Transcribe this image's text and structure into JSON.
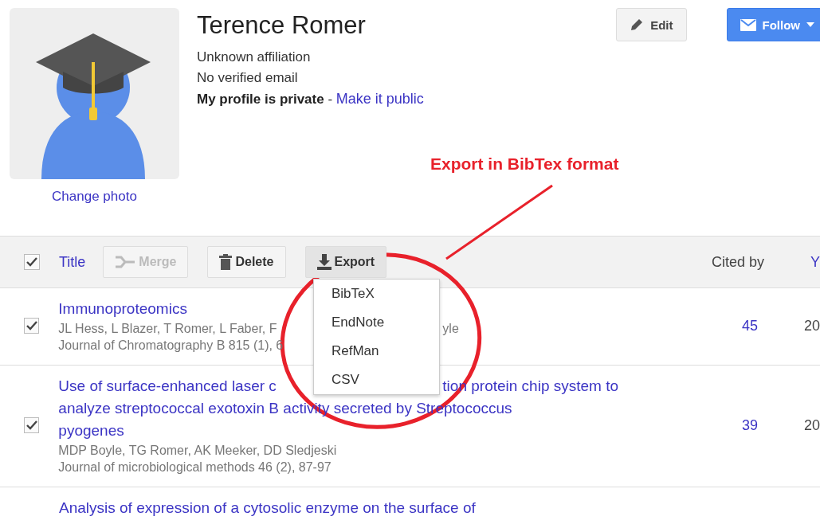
{
  "profile": {
    "name": "Terence Romer",
    "affiliation": "Unknown affiliation",
    "email": "No verified email",
    "privacy": "My profile is private",
    "privacy_separator": "-",
    "privacy_link": "Make it public",
    "change_photo": "Change photo"
  },
  "actions": [
    {
      "label": "Edit",
      "kind": "edit"
    },
    {
      "label": "Follow",
      "kind": "follow"
    }
  ],
  "annotation": {
    "text": "Export in BibTex format"
  },
  "toolbar": {
    "select_all_checked": true,
    "title_column": "Title",
    "buttons": [
      {
        "label": "Merge",
        "kind": "merge",
        "disabled": true
      },
      {
        "label": "Delete",
        "kind": "delete",
        "disabled": false
      },
      {
        "label": "Export",
        "kind": "export",
        "disabled": false
      }
    ],
    "cited_by_column": "Cited by",
    "column_4": "Y"
  },
  "export_menu": {
    "items": [
      "BibTeX",
      "EndNote",
      "RefMan",
      "CSV"
    ]
  },
  "rows": [
    {
      "checked": true,
      "title": [
        [
          "Immunoproteomics"
        ]
      ],
      "authors": [
        "JL Hess, L Blazer, T Romer, L Faber, F",
        "yle"
      ],
      "source": [
        "Journal of Chromatography B 815 (1), 6"
      ],
      "cited_by": "45",
      "column_4": "20"
    },
    {
      "checked": true,
      "title": [
        [
          "Use of surface-enhanced laser c",
          "tion protein chip system to"
        ],
        [
          "analyze streptococcal exotoxin B activity secreted by Streptococcus"
        ],
        [
          "pyogenes"
        ]
      ],
      "authors": [
        "MDP Boyle, TG Romer, AK Meeker, DD Sledjeski"
      ],
      "source": [
        "Journal of microbiological methods 46 (2), 87-97"
      ],
      "cited_by": "39",
      "column_4": "20"
    },
    {
      "title": [
        [
          "Analysis of expression of a cytosolic enzyme on the surface of"
        ]
      ]
    }
  ]
}
